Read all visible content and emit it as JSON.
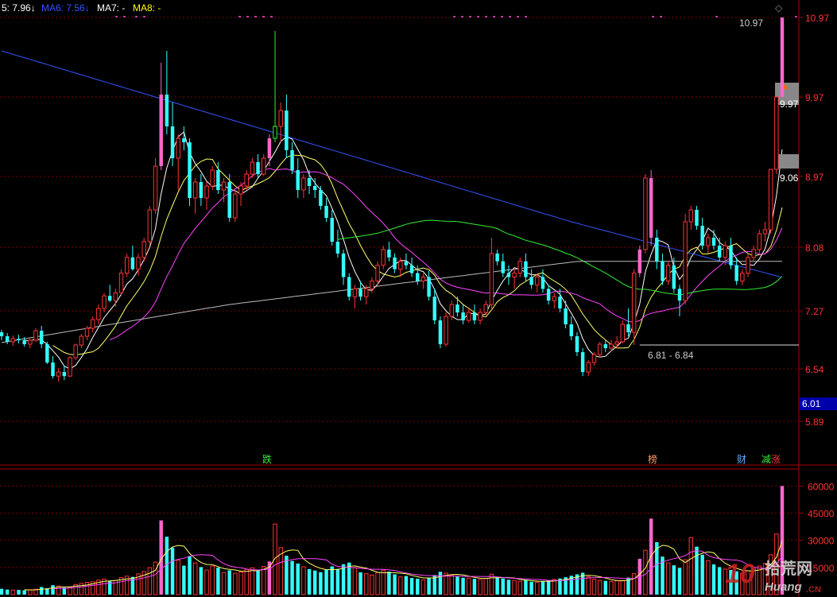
{
  "legend": [
    {
      "label": "5: 7.96",
      "arrow": "↓",
      "color": "#ffffff"
    },
    {
      "label": "MA6: 7.56",
      "arrow": "↓",
      "color": "#3355ff"
    },
    {
      "label": "MA7: -",
      "arrow": "",
      "color": "#ffffff"
    },
    {
      "label": "MA8: -",
      "arrow": "",
      "color": "#ffff00"
    }
  ],
  "colors": {
    "up": "#ff3333",
    "down": "#33ffff",
    "limit_up": "#ff66cc",
    "limit_down": "#33ee33",
    "grid": "#7a0000",
    "price_label": "#ff3333",
    "vol_label": "#ff3333"
  },
  "annotations": {
    "high_label": "10.97",
    "low_label": "6.81 - 6.84",
    "mid_label_1": "9.97",
    "mid_label_2": "9.06",
    "current_price": "6.01",
    "diamond": "◇",
    "arrow": "▲"
  },
  "event_tags": [
    {
      "text": "跌",
      "color": "#33ee33"
    },
    {
      "text": "榜",
      "color": "#ff9966"
    },
    {
      "text": "财",
      "color": "#66aaff"
    },
    {
      "text": "减",
      "color": "#33ee33"
    },
    {
      "text": "涨",
      "color": "#ff3333"
    }
  ],
  "watermark": {
    "brand": "10",
    "cn": "拾荒网",
    "en": "Huang",
    "tld": ".CN"
  },
  "chart_data": [
    {
      "type": "candlestick",
      "title": "",
      "y_ticks": [
        "10.97",
        "9.97",
        "8.97",
        "8.08",
        "7.27",
        "6.54",
        "5.89"
      ],
      "ylim": [
        5.7,
        11.1
      ],
      "grid": true,
      "series_ohlc": [
        [
          7.0,
          7.03,
          6.9,
          6.95
        ],
        [
          6.95,
          6.99,
          6.85,
          6.88
        ],
        [
          6.88,
          6.96,
          6.83,
          6.92
        ],
        [
          6.92,
          6.97,
          6.86,
          6.9
        ],
        [
          6.9,
          6.94,
          6.82,
          6.85
        ],
        [
          6.85,
          6.92,
          6.8,
          6.9
        ],
        [
          6.9,
          7.05,
          6.88,
          7.02
        ],
        [
          7.02,
          7.08,
          6.8,
          6.85
        ],
        [
          6.85,
          6.88,
          6.6,
          6.62
        ],
        [
          6.62,
          6.7,
          6.42,
          6.45
        ],
        [
          6.45,
          6.55,
          6.38,
          6.5
        ],
        [
          6.5,
          6.58,
          6.4,
          6.45
        ],
        [
          6.45,
          6.7,
          6.44,
          6.68
        ],
        [
          6.68,
          6.86,
          6.65,
          6.84
        ],
        [
          6.84,
          6.98,
          6.8,
          6.95
        ],
        [
          6.95,
          7.08,
          6.9,
          7.05
        ],
        [
          7.05,
          7.2,
          7.0,
          7.16
        ],
        [
          7.16,
          7.35,
          7.1,
          7.3
        ],
        [
          7.3,
          7.5,
          7.25,
          7.46
        ],
        [
          7.46,
          7.6,
          7.38,
          7.4
        ],
        [
          7.4,
          7.55,
          7.32,
          7.5
        ],
        [
          7.5,
          7.8,
          7.46,
          7.75
        ],
        [
          7.75,
          8.0,
          7.7,
          7.95
        ],
        [
          7.95,
          8.1,
          7.78,
          7.8
        ],
        [
          7.8,
          8.0,
          7.72,
          7.95
        ],
        [
          7.95,
          8.2,
          7.9,
          8.15
        ],
        [
          8.15,
          8.6,
          8.1,
          8.55
        ],
        [
          8.55,
          9.2,
          8.5,
          9.1
        ],
        [
          9.1,
          10.4,
          9.05,
          10.0
        ],
        [
          10.0,
          10.55,
          9.5,
          9.6
        ],
        [
          9.6,
          9.9,
          9.1,
          9.2
        ],
        [
          9.2,
          9.5,
          8.8,
          9.45
        ],
        [
          9.45,
          9.6,
          9.3,
          9.4
        ],
        [
          9.4,
          9.45,
          8.6,
          8.7
        ],
        [
          8.7,
          8.95,
          8.5,
          8.9
        ],
        [
          8.9,
          9.0,
          8.6,
          8.7
        ],
        [
          8.7,
          8.9,
          8.55,
          8.85
        ],
        [
          8.85,
          9.1,
          8.8,
          9.05
        ],
        [
          9.05,
          9.15,
          8.75,
          8.8
        ],
        [
          8.8,
          8.95,
          8.65,
          8.9
        ],
        [
          8.9,
          9.0,
          8.4,
          8.45
        ],
        [
          8.45,
          8.8,
          8.4,
          8.75
        ],
        [
          8.75,
          8.9,
          8.6,
          8.85
        ],
        [
          8.85,
          9.05,
          8.8,
          9.0
        ],
        [
          9.0,
          9.2,
          8.95,
          9.15
        ],
        [
          9.15,
          9.25,
          8.95,
          9.0
        ],
        [
          9.0,
          9.25,
          8.98,
          9.2
        ],
        [
          9.2,
          9.5,
          9.1,
          9.45
        ],
        [
          9.45,
          10.8,
          9.4,
          9.6
        ],
        [
          9.6,
          9.9,
          9.4,
          9.8
        ],
        [
          9.8,
          10.0,
          9.2,
          9.3
        ],
        [
          9.3,
          9.4,
          9.0,
          9.05
        ],
        [
          9.05,
          9.2,
          8.7,
          8.8
        ],
        [
          8.8,
          9.0,
          8.7,
          8.95
        ],
        [
          8.95,
          9.05,
          8.75,
          8.85
        ],
        [
          8.85,
          8.95,
          8.7,
          8.8
        ],
        [
          8.8,
          8.85,
          8.55,
          8.6
        ],
        [
          8.6,
          8.7,
          8.4,
          8.45
        ],
        [
          8.45,
          8.55,
          8.1,
          8.15
        ],
        [
          8.15,
          8.3,
          7.95,
          8.0
        ],
        [
          8.0,
          8.05,
          7.6,
          7.7
        ],
        [
          7.7,
          7.75,
          7.4,
          7.45
        ],
        [
          7.45,
          7.6,
          7.3,
          7.55
        ],
        [
          7.55,
          7.65,
          7.4,
          7.45
        ],
        [
          7.45,
          7.6,
          7.35,
          7.55
        ],
        [
          7.55,
          7.7,
          7.5,
          7.65
        ],
        [
          7.65,
          7.9,
          7.6,
          7.85
        ],
        [
          7.85,
          8.1,
          7.8,
          8.05
        ],
        [
          8.05,
          8.15,
          7.9,
          7.95
        ],
        [
          7.95,
          8.0,
          7.75,
          7.8
        ],
        [
          7.8,
          7.95,
          7.7,
          7.9
        ],
        [
          7.9,
          8.0,
          7.8,
          7.85
        ],
        [
          7.85,
          7.95,
          7.7,
          7.75
        ],
        [
          7.75,
          7.85,
          7.6,
          7.65
        ],
        [
          7.65,
          7.75,
          7.55,
          7.7
        ],
        [
          7.7,
          7.78,
          7.4,
          7.45
        ],
        [
          7.45,
          7.55,
          7.1,
          7.15
        ],
        [
          7.15,
          7.2,
          6.8,
          6.85
        ],
        [
          6.85,
          7.25,
          6.82,
          7.2
        ],
        [
          7.2,
          7.4,
          7.15,
          7.35
        ],
        [
          7.35,
          7.45,
          7.2,
          7.25
        ],
        [
          7.25,
          7.35,
          7.1,
          7.15
        ],
        [
          7.15,
          7.3,
          7.12,
          7.25
        ],
        [
          7.25,
          7.35,
          7.1,
          7.15
        ],
        [
          7.15,
          7.3,
          7.1,
          7.25
        ],
        [
          7.25,
          7.4,
          7.22,
          7.35
        ],
        [
          7.35,
          8.2,
          7.3,
          8.0
        ],
        [
          8.0,
          8.05,
          7.85,
          7.9
        ],
        [
          7.9,
          8.0,
          7.7,
          7.75
        ],
        [
          7.75,
          7.85,
          7.6,
          7.7
        ],
        [
          7.7,
          7.8,
          7.55,
          7.75
        ],
        [
          7.75,
          7.95,
          7.7,
          7.9
        ],
        [
          7.9,
          8.0,
          7.65,
          7.7
        ],
        [
          7.7,
          7.8,
          7.55,
          7.6
        ],
        [
          7.6,
          7.75,
          7.5,
          7.7
        ],
        [
          7.7,
          7.8,
          7.5,
          7.55
        ],
        [
          7.55,
          7.6,
          7.35,
          7.4
        ],
        [
          7.4,
          7.5,
          7.3,
          7.45
        ],
        [
          7.45,
          7.55,
          7.25,
          7.3
        ],
        [
          7.3,
          7.4,
          7.05,
          7.1
        ],
        [
          7.1,
          7.2,
          6.9,
          6.95
        ],
        [
          6.95,
          7.0,
          6.7,
          6.75
        ],
        [
          6.75,
          6.8,
          6.45,
          6.5
        ],
        [
          6.5,
          6.65,
          6.45,
          6.62
        ],
        [
          6.62,
          6.75,
          6.58,
          6.72
        ],
        [
          6.72,
          6.88,
          6.68,
          6.85
        ],
        [
          6.85,
          6.9,
          6.75,
          6.8
        ],
        [
          6.8,
          6.9,
          6.76,
          6.85
        ],
        [
          6.85,
          6.95,
          6.8,
          6.88
        ],
        [
          6.88,
          7.15,
          6.86,
          7.1
        ],
        [
          7.1,
          7.3,
          6.95,
          7.0
        ],
        [
          7.0,
          7.8,
          6.84,
          7.75
        ],
        [
          7.75,
          8.1,
          7.7,
          8.05
        ],
        [
          8.05,
          9.0,
          8.0,
          8.95
        ],
        [
          8.95,
          9.05,
          8.1,
          8.2
        ],
        [
          8.2,
          8.3,
          7.8,
          7.9
        ],
        [
          7.9,
          8.0,
          7.6,
          7.65
        ],
        [
          7.65,
          7.9,
          7.6,
          7.85
        ],
        [
          7.85,
          7.95,
          7.5,
          7.55
        ],
        [
          7.55,
          7.6,
          7.2,
          7.4
        ],
        [
          7.4,
          8.5,
          7.35,
          8.4
        ],
        [
          8.4,
          8.6,
          8.3,
          8.55
        ],
        [
          8.55,
          8.6,
          8.3,
          8.35
        ],
        [
          8.35,
          8.45,
          8.05,
          8.1
        ],
        [
          8.1,
          8.25,
          8.0,
          8.2
        ],
        [
          8.2,
          8.3,
          8.05,
          8.1
        ],
        [
          8.1,
          8.2,
          7.9,
          7.95
        ],
        [
          7.95,
          8.15,
          7.85,
          8.1
        ],
        [
          8.1,
          8.2,
          7.8,
          7.85
        ],
        [
          7.85,
          7.95,
          7.6,
          7.65
        ],
        [
          7.65,
          7.8,
          7.6,
          7.75
        ],
        [
          7.75,
          8.0,
          7.7,
          7.95
        ],
        [
          7.95,
          8.1,
          7.9,
          8.05
        ],
        [
          8.05,
          8.3,
          8.0,
          8.25
        ],
        [
          8.25,
          8.4,
          8.15,
          8.3
        ],
        [
          8.3,
          9.06,
          8.25,
          9.06
        ],
        [
          9.06,
          9.97,
          9.0,
          9.97
        ],
        [
          9.97,
          10.97,
          9.97,
          10.97
        ]
      ],
      "limit_up_indices": [
        28,
        47,
        112,
        114,
        137,
        138,
        139
      ],
      "limit_down_indices": [
        48
      ],
      "ma_series": [
        {
          "name": "MA5",
          "color": "#ffffff",
          "period": 5
        },
        {
          "name": "MA10",
          "color": "#ffff66",
          "period": 10
        },
        {
          "name": "MA20",
          "color": "#ff44ff",
          "period": 20
        },
        {
          "name": "MA60",
          "color": "#33ee33",
          "period": 60
        },
        {
          "name": "MA6",
          "color": "#3355ff",
          "period": 0
        }
      ],
      "low_marker_index": 112,
      "low_marker_value": 6.84
    },
    {
      "type": "bar",
      "title": "",
      "y_ticks": [
        "60000",
        "45000",
        "30000",
        "15000"
      ],
      "ylim": [
        0,
        65000
      ],
      "values": [
        3200,
        2800,
        2500,
        2600,
        2400,
        2700,
        3000,
        4200,
        3500,
        5200,
        4800,
        3900,
        4100,
        5600,
        6200,
        6800,
        7100,
        8000,
        8600,
        7400,
        7900,
        9400,
        10200,
        9800,
        11500,
        12800,
        14900,
        18000,
        41000,
        32000,
        26000,
        19000,
        16000,
        21000,
        17500,
        15200,
        13600,
        15800,
        14900,
        12200,
        13400,
        11800,
        12500,
        13900,
        14800,
        13200,
        15600,
        18300,
        39000,
        26000,
        21500,
        18600,
        17200,
        15400,
        14100,
        13300,
        12400,
        13800,
        15600,
        14200,
        16800,
        17700,
        14900,
        12300,
        11600,
        10800,
        12200,
        13500,
        12700,
        11200,
        9800,
        10300,
        9200,
        8800,
        8200,
        9400,
        10800,
        12600,
        11900,
        10700,
        9900,
        9300,
        9100,
        8700,
        8300,
        8900,
        11300,
        9600,
        8900,
        8200,
        7800,
        7400,
        7900,
        7100,
        6900,
        7300,
        7800,
        8400,
        8900,
        9600,
        10400,
        11200,
        12100,
        9800,
        8500,
        7900,
        7600,
        7200,
        7700,
        7800,
        9400,
        11600,
        19800,
        24500,
        42000,
        29000,
        21000,
        17500,
        16200,
        14800,
        19300,
        31500,
        26500,
        22000,
        18800,
        16700,
        15200,
        14100,
        13600,
        12900,
        11800,
        13200,
        14400,
        15800,
        17200,
        22000,
        33500,
        60000
      ],
      "ma_lines": [
        {
          "color": "#ffff66",
          "period": 5
        },
        {
          "color": "#ff44ff",
          "period": 10
        }
      ]
    }
  ]
}
